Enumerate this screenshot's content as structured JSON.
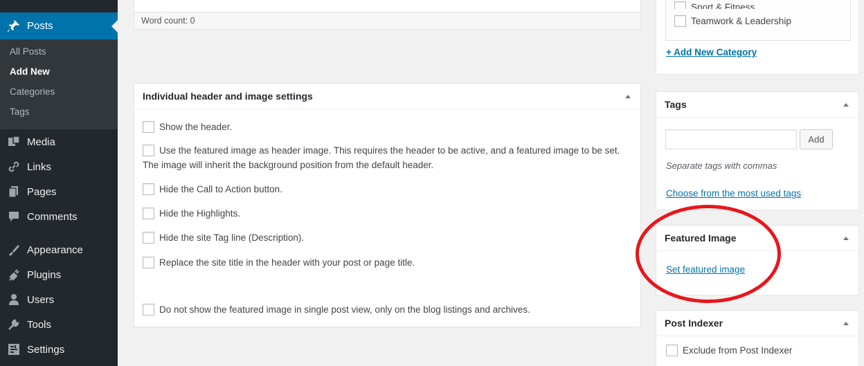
{
  "sidebar": {
    "active_menu": "Posts",
    "submenu": [
      "All Posts",
      "Add New",
      "Categories",
      "Tags"
    ],
    "current_submenu": "Add New",
    "menu": [
      {
        "label": "Media",
        "icon": "media-icon"
      },
      {
        "label": "Links",
        "icon": "links-icon"
      },
      {
        "label": "Pages",
        "icon": "pages-icon"
      },
      {
        "label": "Comments",
        "icon": "comments-icon"
      },
      {
        "label": "Appearance",
        "icon": "appearance-icon"
      },
      {
        "label": "Plugins",
        "icon": "plugins-icon"
      },
      {
        "label": "Users",
        "icon": "users-icon"
      },
      {
        "label": "Tools",
        "icon": "tools-icon"
      },
      {
        "label": "Settings",
        "icon": "settings-icon"
      }
    ]
  },
  "editor": {
    "word_count": "Word count: 0"
  },
  "header_settings": {
    "title": "Individual header and image settings",
    "options": [
      "Show the header.",
      "Use the featured image as header image. This requires the header to be active, and a featured image to be set.",
      "The image will inherit the background position from the default header.",
      "Hide the Call to Action button.",
      "Hide the Highlights.",
      "Hide the site Tag line (Description).",
      "Replace the site title in the header with your post or page title.",
      "Do not show the featured image in single post view, only on the blog listings and archives."
    ]
  },
  "categories": {
    "items": [
      "Sport & Fitness",
      "Teamwork & Leadership"
    ],
    "add_new": "+ Add New Category"
  },
  "tags": {
    "title": "Tags",
    "input_value": "",
    "add_button": "Add",
    "hint": "Separate tags with commas",
    "choose_link": "Choose from the most used tags"
  },
  "featured_image": {
    "title": "Featured Image",
    "set_link": "Set featured image"
  },
  "post_indexer": {
    "title": "Post Indexer",
    "option": "Exclude from Post Indexer"
  },
  "colors": {
    "admin_bar": "#23282d",
    "active_blue": "#0073aa",
    "highlight_ring": "#e8161b"
  }
}
